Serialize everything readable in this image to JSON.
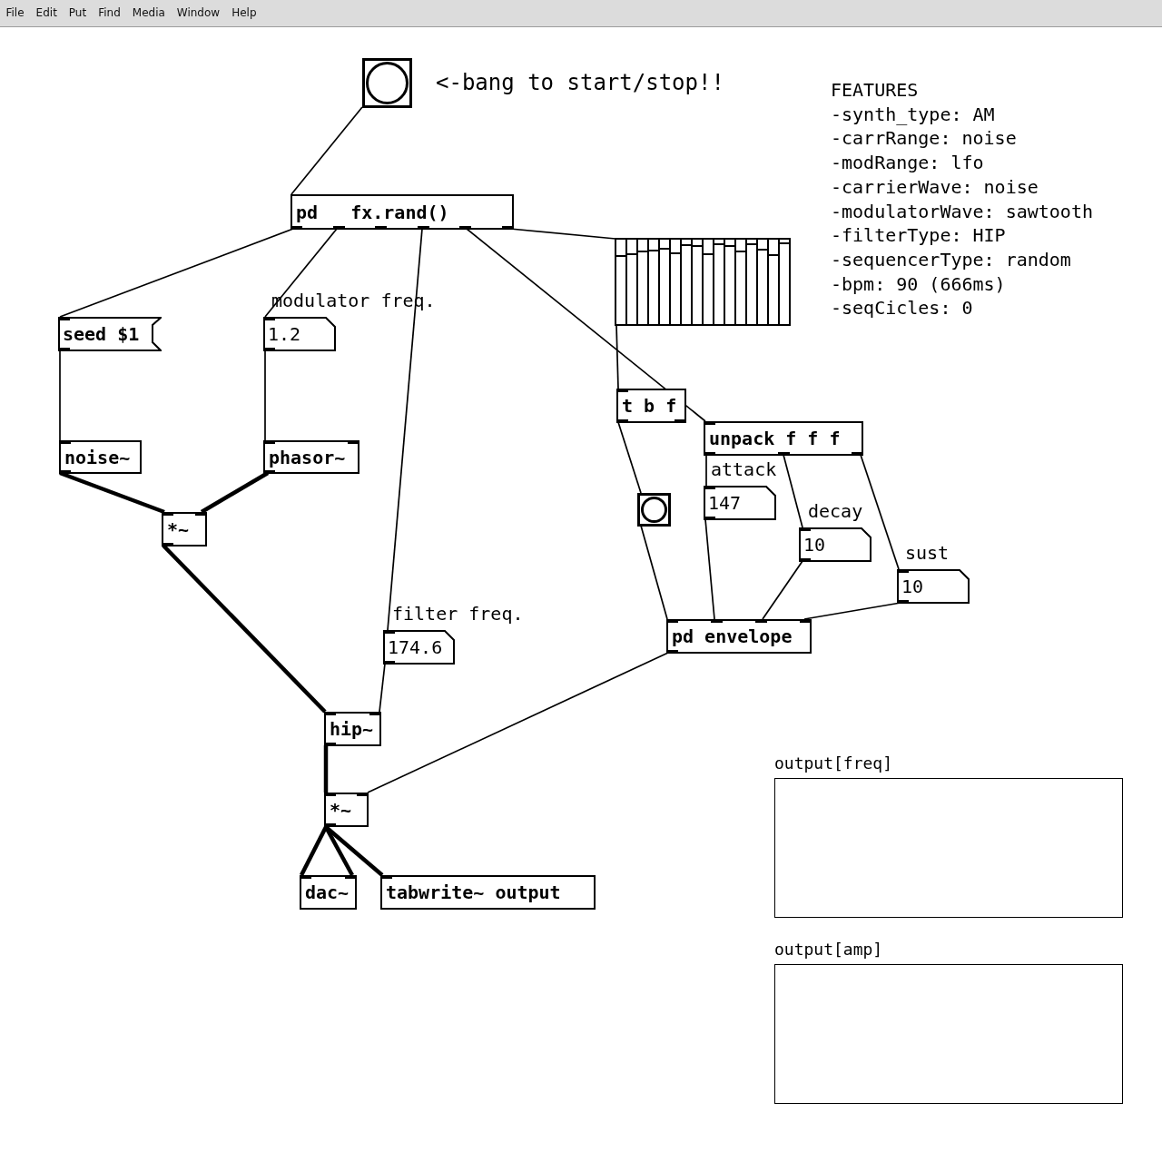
{
  "menu_bar": [
    "File",
    "Edit",
    "Put",
    "Find",
    "Media",
    "Window",
    "Help"
  ],
  "canvas": {
    "nodes": [
      {
        "kind": "bang"
      },
      {
        "kind": "comment",
        "text": "<-bang to start/stop!!"
      },
      {
        "kind": "comment_block",
        "lines": [
          "FEATURES",
          "-synth_type: AM",
          "-carrRange: noise",
          "-modRange: lfo",
          "-carrierWave: noise",
          "-modulatorWave: sawtooth",
          "-filterType: HIP",
          "-sequencerType: random",
          "-bpm: 90 (666ms)",
          "-seqCicles: 0"
        ]
      },
      {
        "kind": "object",
        "text": "pd   fx.rand()"
      },
      {
        "kind": "slider_array",
        "sliders": [
          {
            "level": 0.81
          },
          {
            "level": 0.83
          },
          {
            "level": 0.86
          },
          {
            "level": 0.87
          },
          {
            "level": 0.89
          },
          {
            "level": 0.84
          },
          {
            "level": 0.94
          },
          {
            "level": 0.93
          },
          {
            "level": 0.83
          },
          {
            "level": 0.95
          },
          {
            "level": 0.92
          },
          {
            "level": 0.86
          },
          {
            "level": 0.95
          },
          {
            "level": 0.88
          },
          {
            "level": 0.82
          },
          {
            "level": 0.96
          }
        ]
      },
      {
        "kind": "comment",
        "text": "modulator freq."
      },
      {
        "kind": "message",
        "text": "seed $1"
      },
      {
        "kind": "number",
        "value": "1.2"
      },
      {
        "kind": "object",
        "text": "t b f"
      },
      {
        "kind": "object",
        "text": "unpack f f f"
      },
      {
        "kind": "object",
        "text": "noise~"
      },
      {
        "kind": "object",
        "text": "phasor~"
      },
      {
        "kind": "comment",
        "text": "attack"
      },
      {
        "kind": "number",
        "value": "147"
      },
      {
        "kind": "bang"
      },
      {
        "kind": "comment",
        "text": "decay"
      },
      {
        "kind": "object",
        "text": "*~"
      },
      {
        "kind": "number",
        "value": "10"
      },
      {
        "kind": "comment",
        "text": "sust"
      },
      {
        "kind": "number",
        "value": "10"
      },
      {
        "kind": "comment",
        "text": "filter freq."
      },
      {
        "kind": "object",
        "text": "pd envelope"
      },
      {
        "kind": "number",
        "value": "174.6"
      },
      {
        "kind": "object",
        "text": "hip~"
      },
      {
        "kind": "array",
        "name": "output[freq]"
      },
      {
        "kind": "object",
        "text": "*~"
      },
      {
        "kind": "object",
        "text": "dac~"
      },
      {
        "kind": "object",
        "text": "tabwrite~ output"
      },
      {
        "kind": "array",
        "name": "output[amp]"
      }
    ]
  }
}
